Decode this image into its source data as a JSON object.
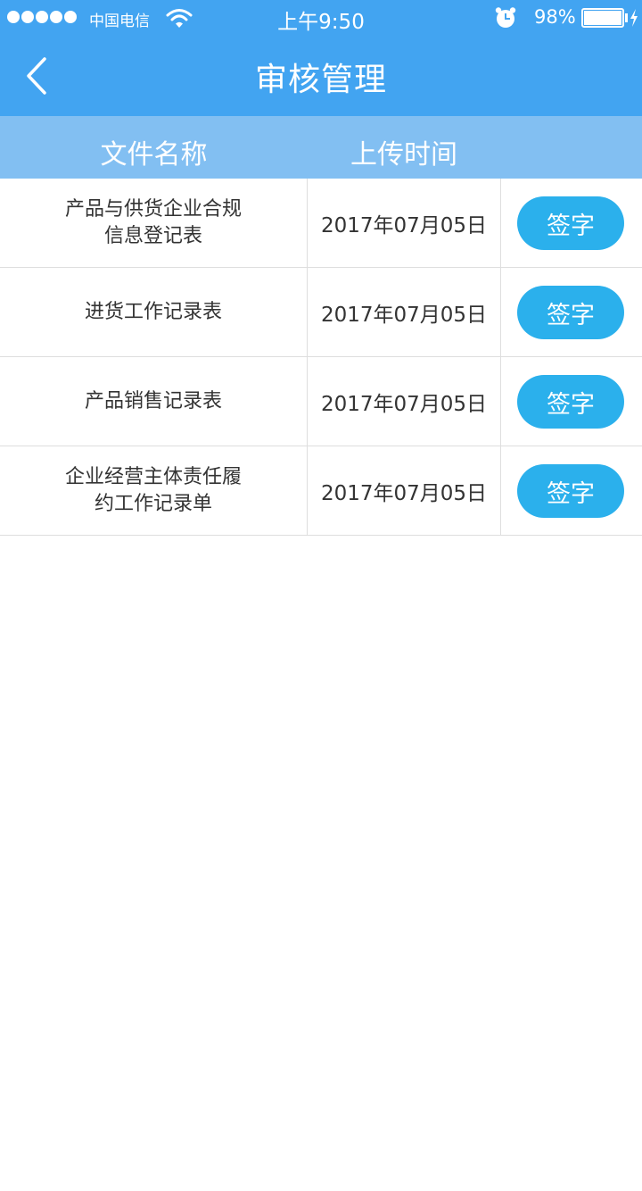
{
  "status_bar": {
    "carrier": "中国电信",
    "time": "上午9:50",
    "battery": "98%",
    "icons": [
      "signal-dots-icon",
      "wifi-icon",
      "alarm-icon",
      "battery-icon",
      "charging-bolt-icon"
    ]
  },
  "nav": {
    "title": "审核管理",
    "back_icon": "chevron-left-icon"
  },
  "table": {
    "headers": [
      "文件名称",
      "上传时间"
    ],
    "rows": [
      {
        "name": "产品与供货企业合规信息登记表",
        "time": "2017年07月05日",
        "action": "签字"
      },
      {
        "name": "进货工作记录表",
        "time": "2017年07月05日",
        "action": "签字"
      },
      {
        "name": "产品销售记录表",
        "time": "2017年07月05日",
        "action": "签字"
      },
      {
        "name": "企业经营主体责任履约工作记录单",
        "time": "2017年07月05日",
        "action": "签字"
      }
    ]
  },
  "colors": {
    "primary": "#42a4f1",
    "header_row": "#82bff2",
    "button": "#2bb0ec",
    "divider": "#dedede",
    "text": "#333333"
  }
}
